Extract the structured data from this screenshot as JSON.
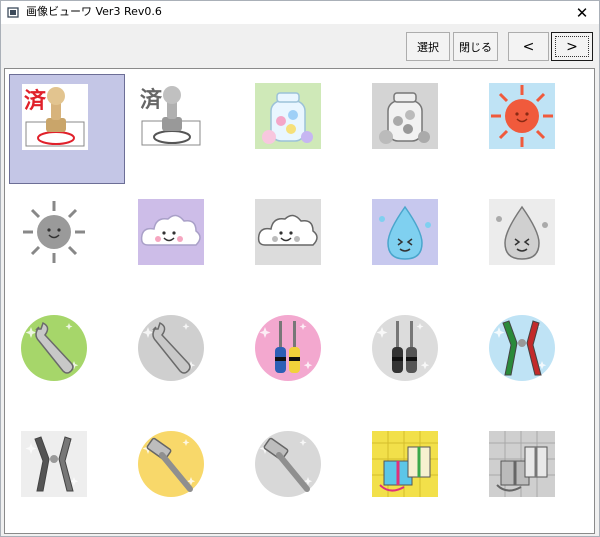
{
  "window": {
    "title": "画像ビューワ Ver3 Rev0.6",
    "close_glyph": "✕"
  },
  "toolbar": {
    "select_label": "選択",
    "close_label": "閉じる",
    "prev_label": "<",
    "next_label": ">"
  },
  "thumbnails": [
    {
      "icon": "stamp-done-color-icon",
      "glyph": "済",
      "selected": true
    },
    {
      "icon": "stamp-done-gray-icon",
      "glyph": "済",
      "selected": false
    },
    {
      "icon": "glass-jar-flowers-color-icon",
      "selected": false
    },
    {
      "icon": "glass-jar-flowers-gray-icon",
      "selected": false
    },
    {
      "icon": "sun-color-icon",
      "selected": false
    },
    {
      "icon": "sun-gray-icon",
      "selected": false
    },
    {
      "icon": "cloud-color-icon",
      "selected": false
    },
    {
      "icon": "cloud-gray-icon",
      "selected": false
    },
    {
      "icon": "raindrop-color-icon",
      "selected": false
    },
    {
      "icon": "raindrop-gray-icon",
      "selected": false
    },
    {
      "icon": "wrench-color-icon",
      "selected": false
    },
    {
      "icon": "wrench-gray-icon",
      "selected": false
    },
    {
      "icon": "screwdrivers-color-icon",
      "selected": false
    },
    {
      "icon": "screwdrivers-gray-icon",
      "selected": false
    },
    {
      "icon": "pliers-color-icon",
      "selected": false
    },
    {
      "icon": "pliers-gray-icon",
      "selected": false
    },
    {
      "icon": "hammer-color-icon",
      "selected": false
    },
    {
      "icon": "hammer-gray-icon",
      "selected": false
    },
    {
      "icon": "gift-boxes-color-icon",
      "selected": false
    },
    {
      "icon": "gift-boxes-gray-icon",
      "selected": false
    }
  ],
  "colors": {
    "selection": "#c4c6e6",
    "stamp_red": "#e0202a",
    "sun_red": "#f05a3c",
    "sky_blue": "#bfe3f5",
    "cloud_purple": "#cdbde8",
    "drop_blue": "#7fd0f0",
    "green_bg": "#a6d66a",
    "pink_bg": "#f3a8cf",
    "yellow_bg": "#f8d86a",
    "gift_yellow": "#f2e04a"
  }
}
